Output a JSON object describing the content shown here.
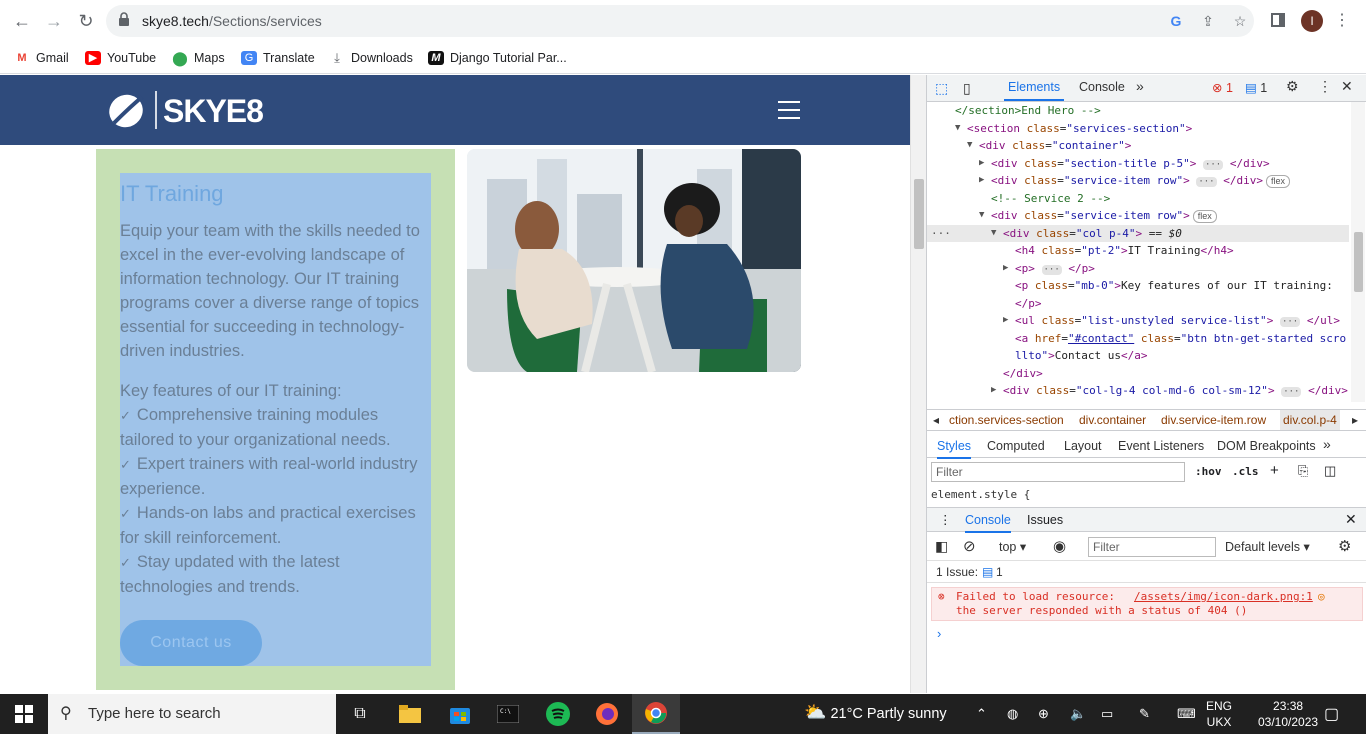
{
  "browser": {
    "url_host": "skye8.tech",
    "url_path": "/Sections/services",
    "avatar_initial": "I",
    "bookmarks": [
      {
        "label": "Gmail",
        "icon": "gmail-icon",
        "color": "#ea4335"
      },
      {
        "label": "YouTube",
        "icon": "youtube-icon",
        "color": "#ff0000"
      },
      {
        "label": "Maps",
        "icon": "maps-icon",
        "color": "#34a853"
      },
      {
        "label": "Translate",
        "icon": "translate-icon",
        "color": "#4285f4"
      },
      {
        "label": "Downloads",
        "icon": "download-icon",
        "color": "#5f6368"
      },
      {
        "label": "Django Tutorial Par...",
        "icon": "django-icon",
        "color": "#111111"
      }
    ]
  },
  "site": {
    "logo_text": "SKYE8",
    "header_color": "#2f4b7c",
    "service": {
      "title": "IT Training",
      "description": "Equip your team with the skills needed to excel in the ever-evolving landscape of information technology. Our IT training programs cover a diverse range of topics essential for succeeding in technology-driven industries.",
      "features_heading": "Key features of our IT training:",
      "features": [
        "Comprehensive training modules tailored to your organizational needs.",
        "Expert trainers with real-world industry experience.",
        "Hands-on labs and practical exercises for skill reinforcement.",
        "Stay updated with the latest technologies and trends."
      ],
      "cta_label": "Contact us"
    }
  },
  "devtools": {
    "tabs": [
      "Elements",
      "Console"
    ],
    "error_count": "1",
    "message_count": "1",
    "dom_lines": [
      {
        "indent": 0,
        "html": "<span class='cm'>&lt;/section&gt;End Hero --&gt;</span>"
      },
      {
        "indent": 1,
        "toggle": "▼",
        "html": "<span class='tag'>&lt;section</span> <span class='an'>class</span>=<span class='av'>\"services-section\"</span><span class='tag'>&gt;</span>"
      },
      {
        "indent": 2,
        "toggle": "▼",
        "html": "<span class='tag'>&lt;div</span> <span class='an'>class</span>=<span class='av'>\"container\"</span><span class='tag'>&gt;</span>"
      },
      {
        "indent": 3,
        "toggle": "▶",
        "html": "<span class='tag'>&lt;div</span> <span class='an'>class</span>=<span class='av'>\"section-title p-5\"</span><span class='tag'>&gt;</span> <span class='ell'>···</span> <span class='tag'>&lt;/div&gt;</span>"
      },
      {
        "indent": 3,
        "toggle": "▶",
        "html": "<span class='tag'>&lt;div</span> <span class='an'>class</span>=<span class='av'>\"service-item row\"</span><span class='tag'>&gt;</span> <span class='ell'>···</span> <span class='tag'>&lt;/div&gt;</span><span class='flex-badge'>flex</span>"
      },
      {
        "indent": 3,
        "html": "<span class='cm'>&lt;!-- Service 2 --&gt;</span>"
      },
      {
        "indent": 3,
        "toggle": "▼",
        "html": "<span class='tag'>&lt;div</span> <span class='an'>class</span>=<span class='av'>\"service-item row\"</span><span class='tag'>&gt;</span><span class='flex-badge'>flex</span>"
      },
      {
        "indent": 4,
        "toggle": "▼",
        "sel": true,
        "html": "<span class='tag'>&lt;div</span> <span class='an'>class</span>=<span class='av'>\"col p-4\"</span><span class='tag'>&gt;</span> <span class='tx'>== <i>$0</i></span>"
      },
      {
        "indent": 5,
        "html": "<span class='tag'>&lt;h4</span> <span class='an'>class</span>=<span class='av'>\"pt-2\"</span><span class='tag'>&gt;</span><span class='tx'>IT Training</span><span class='tag'>&lt;/h4&gt;</span>"
      },
      {
        "indent": 5,
        "toggle": "▶",
        "html": "<span class='tag'>&lt;p&gt;</span> <span class='ell'>···</span> <span class='tag'>&lt;/p&gt;</span>"
      },
      {
        "indent": 5,
        "html": "<span class='tag'>&lt;p</span> <span class='an'>class</span>=<span class='av'>\"mb-0\"</span><span class='tag'>&gt;</span><span class='tx'>Key features of our IT training:</span>"
      },
      {
        "indent": 5,
        "html": "<span class='tag'>&lt;/p&gt;</span>"
      },
      {
        "indent": 5,
        "toggle": "▶",
        "html": "<span class='tag'>&lt;ul</span> <span class='an'>class</span>=<span class='av'>\"list-unstyled service-list\"</span><span class='tag'>&gt;</span> <span class='ell'>···</span> <span class='tag'>&lt;/ul&gt;</span>"
      },
      {
        "indent": 5,
        "html": "<span class='tag'>&lt;a</span> <span class='an'>href</span>=<span class='av'><u>\"#contact\"</u></span> <span class='an'>class</span>=<span class='av'>\"btn btn-get-started scro</span>"
      },
      {
        "indent": 5,
        "html": "<span class='av'>llto\"</span><span class='tag'>&gt;</span><span class='tx'>Contact us</span><span class='tag'>&lt;/a&gt;</span>"
      },
      {
        "indent": 4,
        "html": "<span class='tag'>&lt;/div&gt;</span>"
      },
      {
        "indent": 4,
        "toggle": "▶",
        "html": "<span class='tag'>&lt;div</span> <span class='an'>class</span>=<span class='av'>\"col-lg-4 col-md-6 col-sm-12\"</span><span class='tag'>&gt;</span> <span class='ell'>···</span> <span class='tag'>&lt;/div&gt;</span>"
      },
      {
        "indent": 3,
        "html": "<span class='tag'>&lt;/div&gt;</span>"
      }
    ],
    "breadcrumbs": [
      "ction.services-section",
      "div.container",
      "div.service-item.row",
      "div.col.p-4"
    ],
    "styles_tabs": [
      "Styles",
      "Computed",
      "Layout",
      "Event Listeners",
      "DOM Breakpoints"
    ],
    "filter_placeholder": "Filter",
    "hov_label": ":hov",
    "cls_label": ".cls",
    "element_style": "element.style {",
    "console": {
      "tabs": [
        "Console",
        "Issues"
      ],
      "context": "top",
      "filter_placeholder": "Filter",
      "levels": "Default levels",
      "issues_label": "1 Issue:",
      "issues_count": "1",
      "error_text_1": "Failed to load resource:",
      "error_link": "/assets/img/icon-dark.png:1",
      "error_text_2": "the server responded with a status of 404 ()"
    }
  },
  "taskbar": {
    "search_placeholder": "Type here to search",
    "weather": "21°C  Partly sunny",
    "lang_1": "ENG",
    "lang_2": "UKX",
    "time": "23:38",
    "date": "03/10/2023"
  }
}
